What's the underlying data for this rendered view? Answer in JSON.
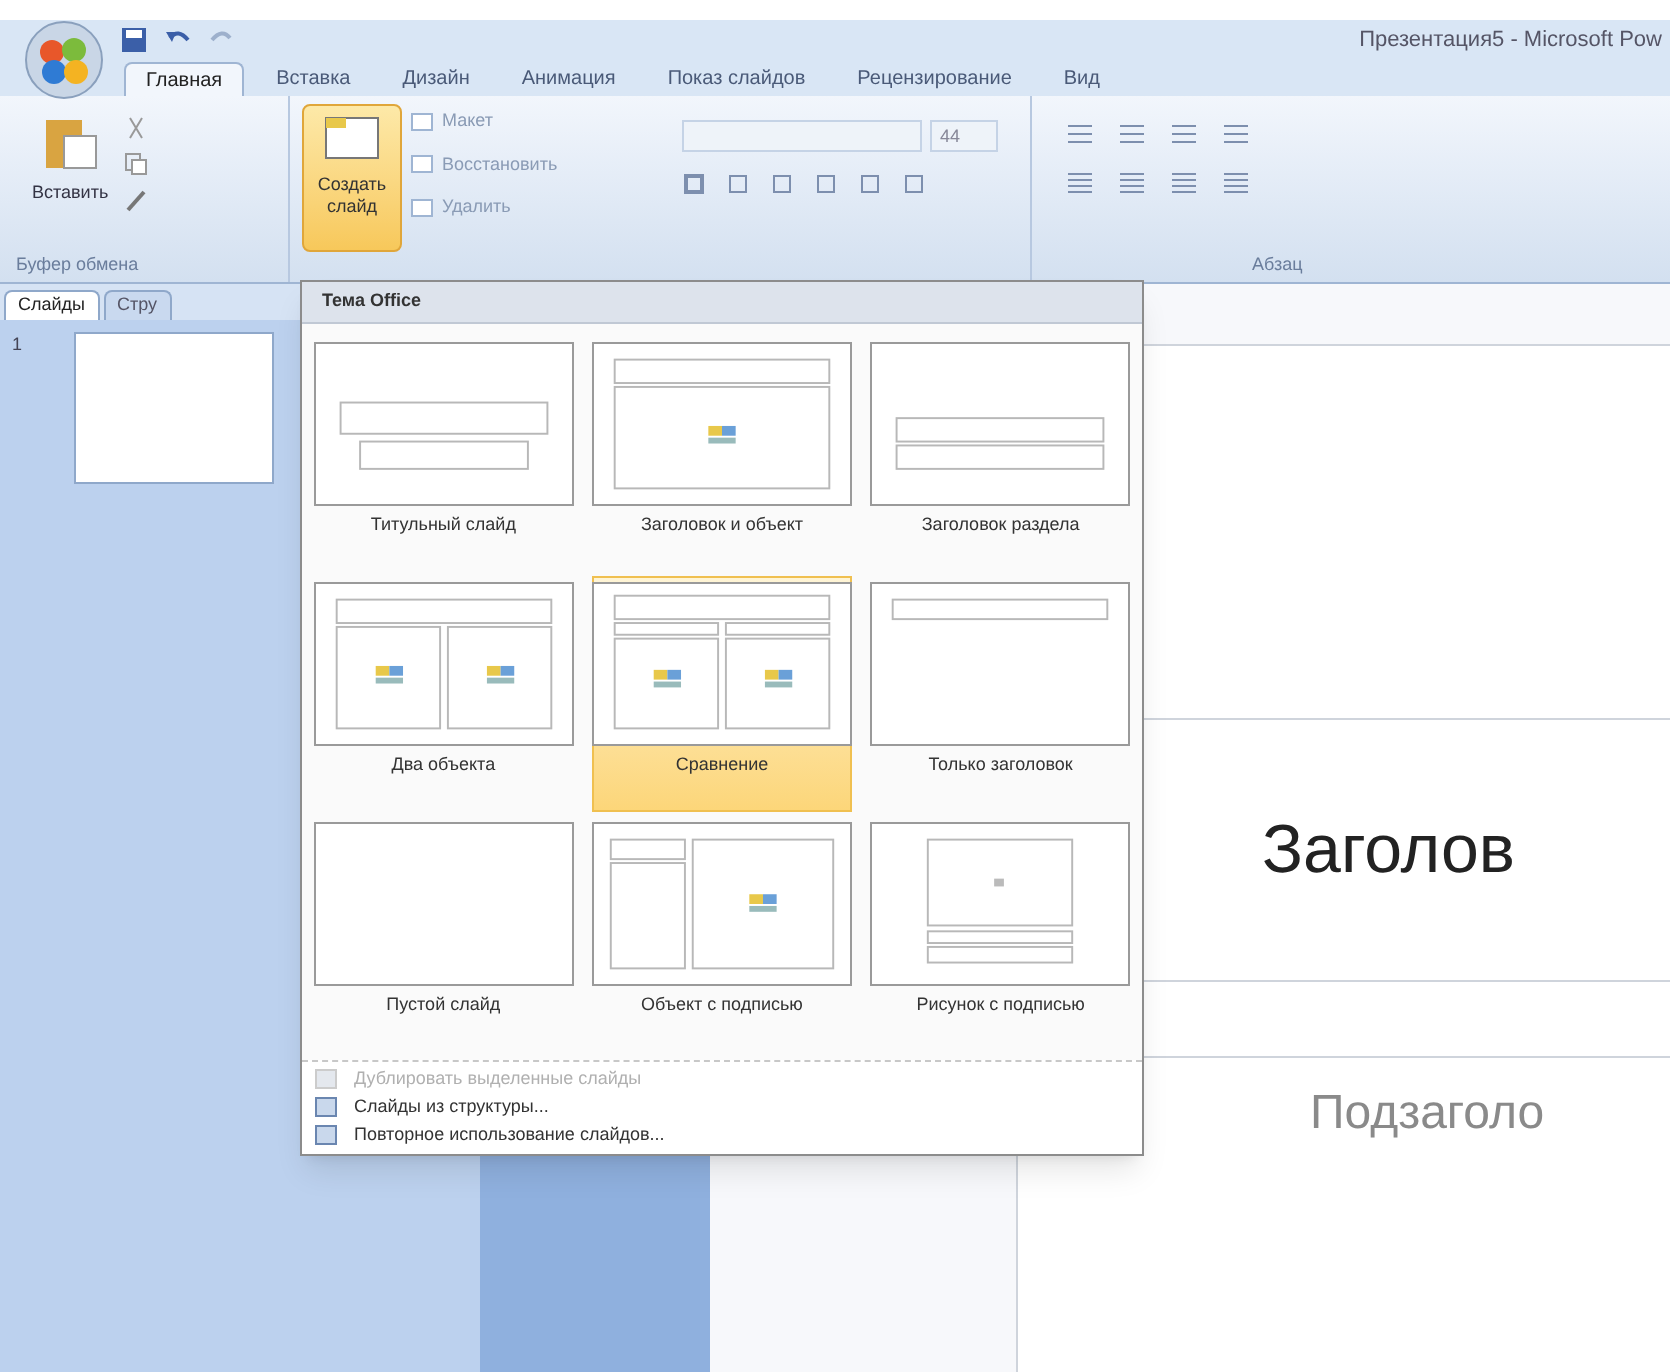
{
  "window": {
    "title": "Презентация5 - Microsoft Pow"
  },
  "tabs": [
    {
      "label": "Главная",
      "selected": true
    },
    {
      "label": "Вставка",
      "selected": false
    },
    {
      "label": "Дизайн",
      "selected": false
    },
    {
      "label": "Анимация",
      "selected": false
    },
    {
      "label": "Показ слайдов",
      "selected": false
    },
    {
      "label": "Рецензирование",
      "selected": false
    },
    {
      "label": "Вид",
      "selected": false
    }
  ],
  "ribbon": {
    "paste": "Вставить",
    "clipboard_group": "Буфер обмена",
    "new_slide": "Создать слайд",
    "layout": "Макет",
    "reset": "Восстановить",
    "delete": "Удалить",
    "font_size": "44",
    "paragraph_group": "Абзац"
  },
  "slide_number": "1",
  "pane_tabs": [
    {
      "label": "Слайды",
      "selected": true
    },
    {
      "label": "Стру",
      "selected": false
    }
  ],
  "layout_menu": {
    "header": "Тема Office",
    "layouts": [
      {
        "kind": "title",
        "label": "Титульный слайд",
        "selected": false
      },
      {
        "kind": "title-content",
        "label": "Заголовок и объект",
        "selected": false
      },
      {
        "kind": "section",
        "label": "Заголовок раздела",
        "selected": false
      },
      {
        "kind": "two-content",
        "label": "Два объекта",
        "selected": false
      },
      {
        "kind": "comparison",
        "label": "Сравнение",
        "selected": true
      },
      {
        "kind": "title-only",
        "label": "Только заголовок",
        "selected": false
      },
      {
        "kind": "blank",
        "label": "Пустой слайд",
        "selected": false
      },
      {
        "kind": "content-caption",
        "label": "Объект с подписью",
        "selected": false
      },
      {
        "kind": "picture-caption",
        "label": "Рисунок с подписью",
        "selected": false
      }
    ],
    "commands": [
      {
        "label": "Дублировать выделенные слайды",
        "disabled": true
      },
      {
        "label": "Слайды из структуры...",
        "disabled": false
      },
      {
        "label": "Повторное использование слайдов...",
        "disabled": false
      }
    ]
  },
  "slide": {
    "title": "Заголов",
    "subtitle": "Подзаголо"
  }
}
